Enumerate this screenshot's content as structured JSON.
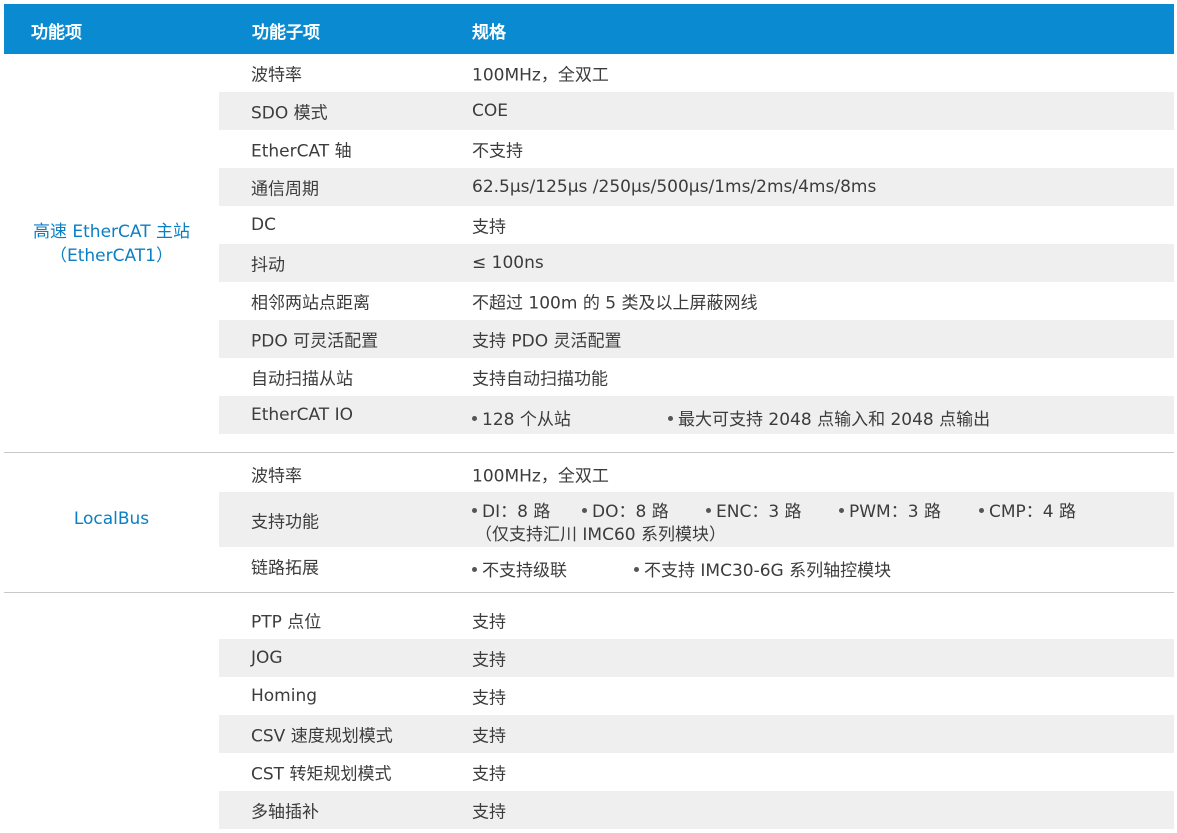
{
  "header": {
    "col1": "功能项",
    "col2": "功能子项",
    "col3": "规格"
  },
  "groups": [
    {
      "label_line1": "高速 EtherCAT 主站",
      "label_line2": "（EtherCAT1）",
      "rows": [
        {
          "sub": "波特率",
          "spec": "100MHz，全双工"
        },
        {
          "sub": "SDO 模式",
          "spec": "COE"
        },
        {
          "sub": "EtherCAT 轴",
          "spec": "不支持"
        },
        {
          "sub": "通信周期",
          "spec": "62.5μs/125μs /250μs/500μs/1ms/2ms/4ms/8ms"
        },
        {
          "sub": "DC",
          "spec": "支持"
        },
        {
          "sub": "抖动",
          "spec": "≤ 100ns"
        },
        {
          "sub": "相邻两站点距离",
          "spec": "不超过 100m 的 5 类及以上屏蔽网线"
        },
        {
          "sub": "PDO 可灵活配置",
          "spec": "支持 PDO 灵活配置"
        },
        {
          "sub": "自动扫描从站",
          "spec": "支持自动扫描功能"
        },
        {
          "sub": "EtherCAT IO",
          "bullets": [
            "128 个从站",
            "最大可支持 2048 点输入和 2048 点输出"
          ]
        }
      ]
    },
    {
      "label_line1": "LocalBus",
      "rows": [
        {
          "sub": "波特率",
          "spec": "100MHz，全双工"
        },
        {
          "sub": "支持功能",
          "bullets": [
            "DI：8 路",
            "DO：8 路",
            "ENC：3 路",
            "PWM：3 路",
            "CMP：4 路"
          ],
          "note": "（仅支持汇川 IMC60 系列模块）"
        },
        {
          "sub": "链路拓展",
          "bullets": [
            "不支持级联",
            "不支持 IMC30-6G 系列轴控模块"
          ]
        }
      ]
    },
    {
      "rows": [
        {
          "sub": "PTP 点位",
          "spec": "支持"
        },
        {
          "sub": "JOG",
          "spec": "支持"
        },
        {
          "sub": "Homing",
          "spec": "支持"
        },
        {
          "sub": "CSV 速度规划模式",
          "spec": "支持"
        },
        {
          "sub": "CST 转矩规划模式",
          "spec": "支持"
        },
        {
          "sub": "多轴插补",
          "spec": "支持"
        }
      ]
    }
  ],
  "colors": {
    "header_bg": "#0a8ad1",
    "group_label": "#0a7fc4",
    "alt_row": "#efefef"
  }
}
